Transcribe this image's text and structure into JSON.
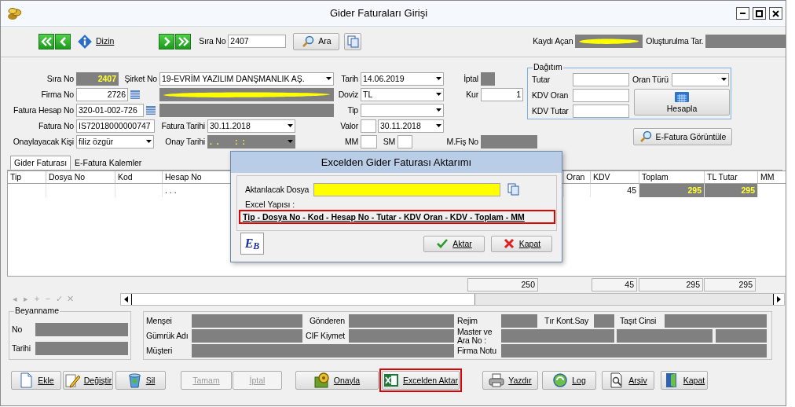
{
  "window": {
    "title": "Gider Faturaları Girişi"
  },
  "toolbar": {
    "index_button": "Dizin",
    "record_label": "Sıra No",
    "record_value": "2407",
    "search_button": "Ara",
    "created_by": {
      "label": "Kaydı Açan",
      "redacted": true,
      "disabled": true
    },
    "created_at": {
      "label": "Oluşturulma Tar.",
      "disabled": true
    }
  },
  "form_rows": [
    [
      {
        "kind": "label",
        "text": "Sıra No"
      },
      {
        "kind": "number",
        "value": "2407",
        "disabled": true
      },
      {
        "kind": "label",
        "text": "Şirket No"
      },
      {
        "kind": "select",
        "value": "19-EVRİM YAZILIM DANŞMANLIK AŞ.",
        "disabled": false
      },
      {
        "kind": "label",
        "text": "Tarih"
      },
      {
        "kind": "select",
        "value": "14.06.2019",
        "disabled": false
      },
      {
        "kind": "label",
        "text": "İptal"
      },
      {
        "kind": "field",
        "disabled": true
      }
    ],
    [
      {
        "kind": "label",
        "text": "Firma No"
      },
      {
        "kind": "number_lookup",
        "value": "2726",
        "disabled": false
      },
      {
        "kind": "field",
        "disabled": true,
        "redacted": true
      },
      {
        "kind": "label",
        "text": "Doviz"
      },
      {
        "kind": "select",
        "value": "TL",
        "disabled": false
      },
      {
        "kind": "label",
        "text": "Kur"
      },
      {
        "kind": "number",
        "value": "1",
        "disabled": false
      }
    ],
    [
      {
        "kind": "label",
        "text": "Fatura Hesap No"
      },
      {
        "kind": "lookup",
        "value": "320-01-002-726",
        "disabled": false
      },
      {
        "kind": "field",
        "disabled": true
      },
      {
        "kind": "label",
        "text": "Tip"
      },
      {
        "kind": "select",
        "disabled": false
      }
    ],
    [
      {
        "kind": "label",
        "text": "Fatura No"
      },
      {
        "kind": "field",
        "value": "IS72018000000747",
        "disabled": false
      },
      {
        "kind": "label",
        "text": "Fatura Tarihi"
      },
      {
        "kind": "select",
        "value": "30.11.2018",
        "disabled": false
      },
      {
        "kind": "label",
        "text": "Valor"
      },
      {
        "kind": "field",
        "disabled": false
      },
      {
        "kind": "select",
        "value": "30.11.2018",
        "disabled": false
      }
    ],
    [
      {
        "kind": "label",
        "text": "Onaylayacak Kişi"
      },
      {
        "kind": "select",
        "value": "filiz özgür",
        "disabled": false
      },
      {
        "kind": "label",
        "text": "Onay Tarihi"
      },
      {
        "kind": "select",
        "value": ".  .       :  :",
        "disabled": true
      },
      {
        "kind": "label",
        "text": "MM"
      },
      {
        "kind": "field",
        "disabled": false
      },
      {
        "kind": "label",
        "text": "SM"
      },
      {
        "kind": "field",
        "disabled": false
      },
      {
        "kind": "label",
        "text": "M.Fiş No"
      },
      {
        "kind": "field",
        "disabled": true
      }
    ]
  ],
  "distribution": {
    "title": "Dağıtım",
    "fields": [
      {
        "label": "Tutar"
      },
      {
        "label": "KDV Oran"
      },
      {
        "label": "KDV Tutar"
      }
    ],
    "rate_type_label": "Oran Türü",
    "calculate_button": "Hesapla"
  },
  "einvoice_button": "E-Fatura Görüntüle",
  "tabs": [
    {
      "label": "Gider Faturası",
      "selected": true
    },
    {
      "label": "E-Fatura Kalemler",
      "selected": false
    }
  ],
  "grid": {
    "columns": [
      {
        "label": "Tip",
        "kind": "text",
        "computed": false
      },
      {
        "label": "Dosya No",
        "kind": "text",
        "computed": false
      },
      {
        "label": "Kod",
        "kind": "text",
        "computed": false
      },
      {
        "label": "Hesap No",
        "kind": "text",
        "computed": false
      },
      {
        "label": "Oran",
        "kind": "number",
        "computed": false
      },
      {
        "label": "KDV",
        "kind": "number",
        "computed": false
      },
      {
        "label": "Toplam",
        "kind": "number",
        "computed": true
      },
      {
        "label": "TL Tutar",
        "kind": "number",
        "computed": true
      },
      {
        "label": "MM",
        "kind": "text",
        "computed": false
      }
    ],
    "rows": [
      {
        "cells": [
          "",
          "",
          "",
          ". . .",
          "",
          "45",
          "295",
          "295",
          ""
        ]
      }
    ],
    "totals": [
      "250",
      "45",
      "295",
      "295"
    ],
    "navigator": [
      "◂",
      "▸",
      "+",
      "−",
      "✓",
      "✕"
    ]
  },
  "dialog": {
    "title": "Excelden Gider Faturası Aktarımı",
    "file_label": "Aktarılacak Dosya",
    "structure_label": "Excel Yapısı :",
    "structure": "Tip - Dosya No - Kod - Hesap No - Tutar - KDV Oran - KDV - Toplam - MM",
    "structure_highlighted": true,
    "logo": "E$_{B}$",
    "buttons": [
      {
        "label": "Aktar",
        "kind": "ok"
      },
      {
        "label": "Kapat",
        "kind": "cancel"
      }
    ]
  },
  "declaration": {
    "title": "Beyanname",
    "fields": [
      {
        "label": "No"
      },
      {
        "label": "Tarihi"
      }
    ]
  },
  "customs": [
    {
      "label": "Menşei"
    },
    {
      "label": "Gönderen"
    },
    {
      "label": "Rejim"
    },
    {
      "label": "Tır Kont.Say"
    },
    {
      "label": "Taşıt Cinsi"
    },
    {
      "label": "Gümrük Adı"
    },
    {
      "label": "CIF Kiymet"
    },
    {
      "label": "Master ve Ara No :"
    },
    {
      "label": "Müşteri"
    },
    {
      "label": "Firma Notu"
    }
  ],
  "buttons": [
    {
      "label": "Ekle",
      "kind": "new",
      "disabled": false,
      "highlighted": false
    },
    {
      "label": "Değiştir",
      "kind": "edit",
      "disabled": false,
      "highlighted": false
    },
    {
      "label": "Sil",
      "kind": "delete",
      "disabled": false,
      "highlighted": false
    },
    {
      "label": "Tamam",
      "kind": "plain",
      "disabled": true,
      "highlighted": false
    },
    {
      "label": "İptal",
      "kind": "plain",
      "disabled": true,
      "highlighted": false
    },
    {
      "label": "Onayla",
      "kind": "approve",
      "disabled": false,
      "highlighted": false
    },
    {
      "label": "Excelden Aktar",
      "kind": "excel",
      "disabled": false,
      "highlighted": true
    },
    {
      "label": "Yazdır",
      "kind": "print",
      "disabled": false,
      "highlighted": false
    },
    {
      "label": "Log",
      "kind": "log",
      "disabled": false,
      "highlighted": false
    },
    {
      "label": "Arşiv",
      "kind": "archive",
      "disabled": false,
      "highlighted": false
    },
    {
      "label": "Kapat",
      "kind": "close",
      "disabled": false,
      "highlighted": false
    }
  ]
}
